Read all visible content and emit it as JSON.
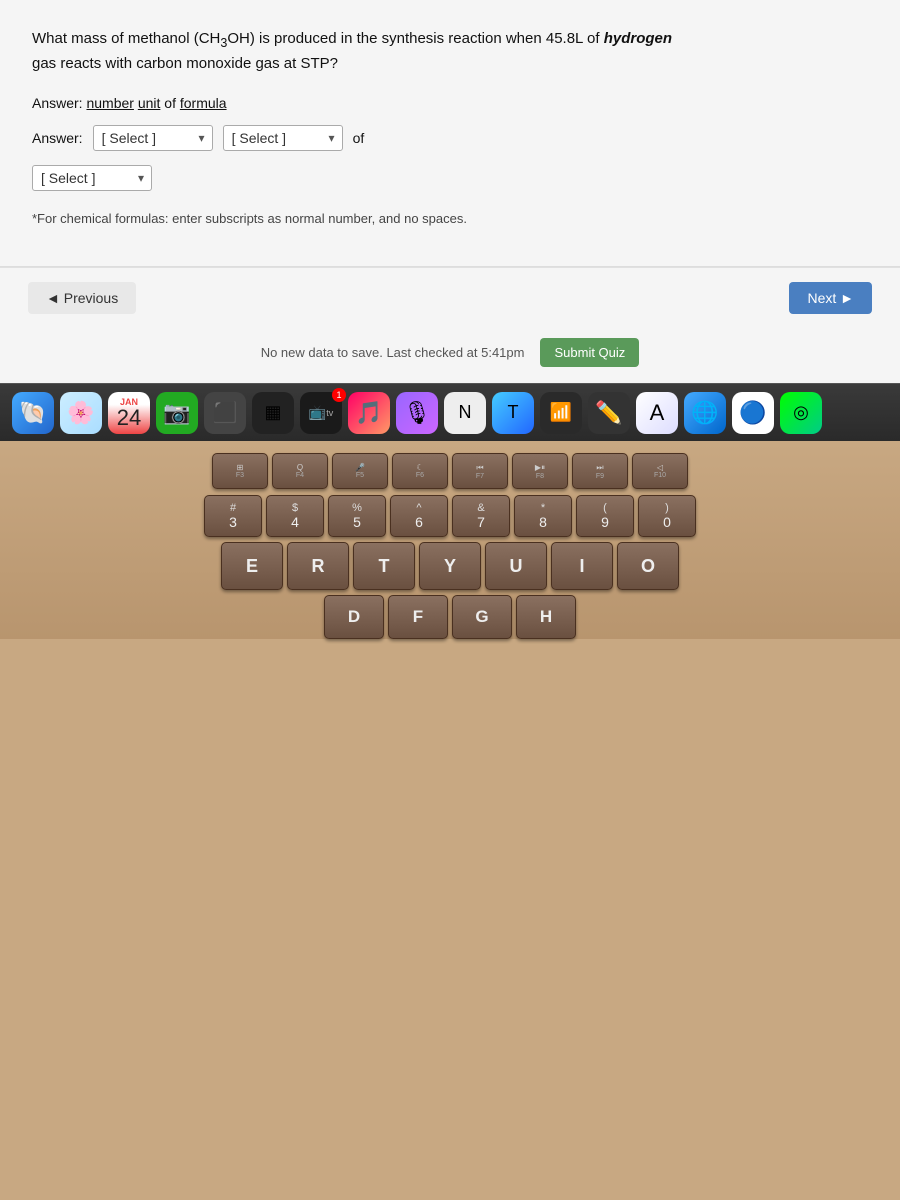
{
  "quiz": {
    "question": "What mass of methanol (CH₃OH) is produced in the synthesis reaction when 45.8L of hydrogen gas reacts with carbon monoxide gas at STP?",
    "answer_format": "Answer: number unit of formula",
    "answer_label": "Answer:",
    "select1_default": "[ Select ]",
    "select2_default": "[ Select ]",
    "of_text": "of",
    "select3_default": "[ Select ]",
    "formula_note": "*For chemical formulas: enter subscripts as normal number, and no spaces.",
    "btn_previous": "◄ Previous",
    "btn_next": "Next ►",
    "status_text": "No new data to save. Last checked at 5:41pm",
    "btn_submit": "Submit Quiz"
  },
  "taskbar": {
    "calendar_month": "JAN",
    "calendar_day": "24",
    "badge_count": "1"
  },
  "keyboard": {
    "fn_keys": [
      "F3",
      "F4",
      "F5",
      "F6",
      "F7",
      "F8",
      "F9",
      "F10"
    ],
    "fn_icons": [
      "⊞",
      "Q",
      "🎤",
      "C",
      "⏮",
      "▶⏸",
      "⏭",
      "DD"
    ],
    "num_row": [
      {
        "top": "#",
        "bot": "3"
      },
      {
        "top": "$",
        "bot": "4"
      },
      {
        "top": "%",
        "bot": "5"
      },
      {
        "top": "^",
        "bot": "6"
      },
      {
        "top": "&",
        "bot": "7"
      },
      {
        "top": "*",
        "bot": "8"
      },
      {
        "top": "(",
        "bot": "9"
      },
      {
        "top": ")",
        "bot": "0"
      }
    ],
    "letter_row1": [
      "E",
      "R",
      "T",
      "Y",
      "U",
      "I",
      "O"
    ],
    "letter_row2": [
      "D",
      "F",
      "G",
      "H"
    ]
  }
}
